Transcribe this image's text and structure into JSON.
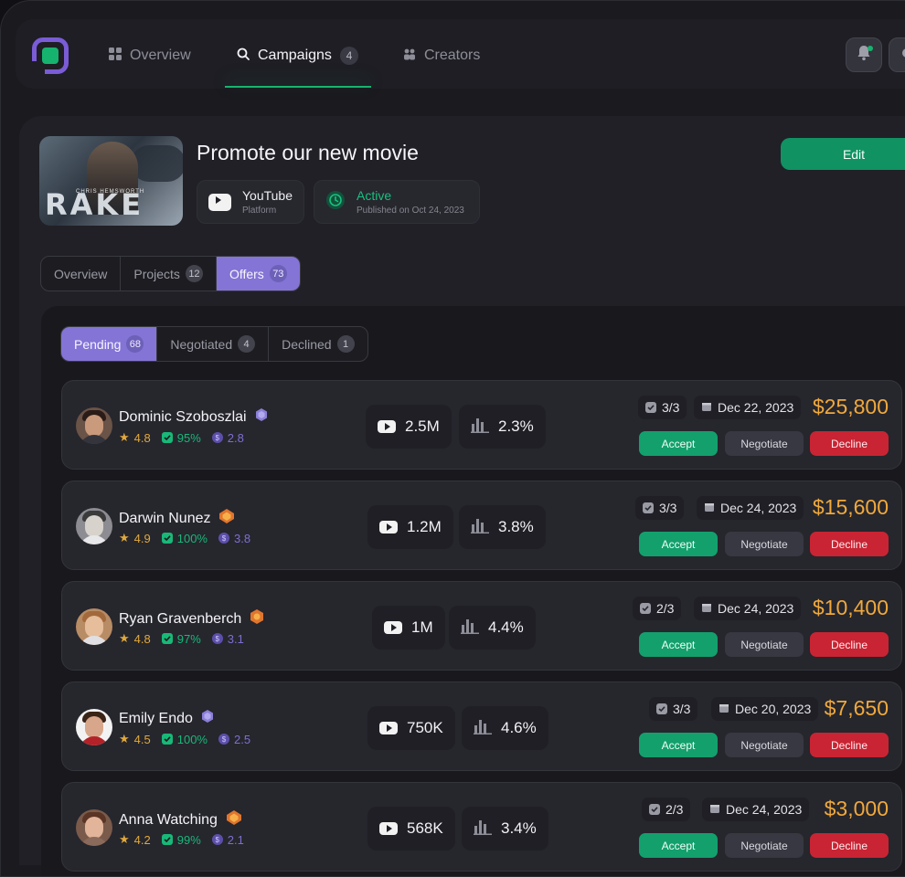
{
  "nav": {
    "tabs": [
      {
        "label": "Overview",
        "icon": "grid-icon"
      },
      {
        "label": "Campaigns",
        "icon": "search-icon",
        "badge": "4"
      },
      {
        "label": "Creators",
        "icon": "users-icon"
      }
    ]
  },
  "campaign": {
    "title": "Promote our new movie",
    "thumbnail_text": "RAKE",
    "thumbnail_sub": "CHRIS HEMSWORTH",
    "platform": {
      "name": "YouTube",
      "label": "Platform"
    },
    "status": {
      "name": "Active",
      "published": "Published on Oct 24, 2023"
    },
    "edit_label": "Edit"
  },
  "tabs": [
    {
      "label": "Overview",
      "count": ""
    },
    {
      "label": "Projects",
      "count": "12"
    },
    {
      "label": "Offers",
      "count": "73"
    }
  ],
  "filters": [
    {
      "label": "Pending",
      "count": "68"
    },
    {
      "label": "Negotiated",
      "count": "4"
    },
    {
      "label": "Declined",
      "count": "1"
    }
  ],
  "buttons": {
    "accept": "Accept",
    "negotiate": "Negotiate",
    "decline": "Decline"
  },
  "offers": [
    {
      "name": "Dominic Szoboszlai",
      "rating": "4.8",
      "completion": "95%",
      "score": "2.8",
      "subs": "2.5M",
      "engagement": "2.3%",
      "tasks": "3/3",
      "date": "Dec 22, 2023",
      "price": "$25,800"
    },
    {
      "name": "Darwin Nunez",
      "rating": "4.9",
      "completion": "100%",
      "score": "3.8",
      "subs": "1.2M",
      "engagement": "3.8%",
      "tasks": "3/3",
      "date": "Dec 24, 2023",
      "price": "$15,600"
    },
    {
      "name": "Ryan Gravenberch",
      "rating": "4.8",
      "completion": "97%",
      "score": "3.1",
      "subs": "1M",
      "engagement": "4.4%",
      "tasks": "2/3",
      "date": "Dec 24, 2023",
      "price": "$10,400"
    },
    {
      "name": "Emily Endo",
      "rating": "4.5",
      "completion": "100%",
      "score": "2.5",
      "subs": "750K",
      "engagement": "4.6%",
      "tasks": "3/3",
      "date": "Dec 20, 2023",
      "price": "$7,650"
    },
    {
      "name": "Anna Watching",
      "rating": "4.2",
      "completion": "99%",
      "score": "2.1",
      "subs": "568K",
      "engagement": "3.4%",
      "tasks": "2/3",
      "date": "Dec 24, 2023",
      "price": "$3,000"
    }
  ],
  "colors": {
    "accent": "#16B36E",
    "purple": "#8374D6",
    "price": "#F0A93C",
    "decline": "#C92433"
  }
}
